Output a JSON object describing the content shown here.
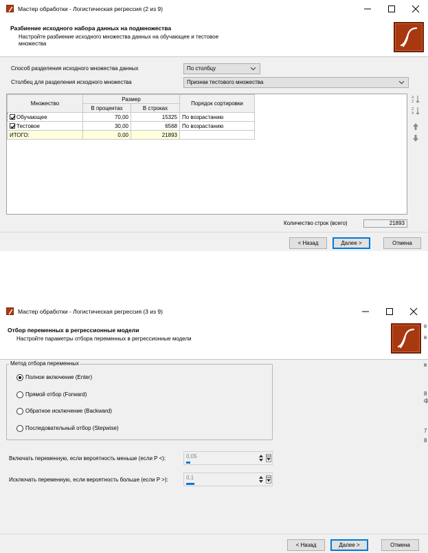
{
  "window1": {
    "title": "Мастер обработки - Логистическая регрессия (2 из 9)",
    "header_title": "Разбиение исходного набора данных на подмножества",
    "header_subtitle": "Настройте разбиение исходного множества данных на обучающее и тестовое множества",
    "split_method_label": "Способ разделения исходного множества данных",
    "split_method_value": "По столбцу",
    "split_column_label": "Столбец для разделения исходного множества",
    "split_column_value": "Признак тестового множества",
    "grid": {
      "col_set": "Множество",
      "col_size": "Размер",
      "col_percent": "В процентах",
      "col_rows": "В строках",
      "col_sort": "Порядок сортировки",
      "rows": [
        {
          "name": "Обучающее",
          "percent": "70,00",
          "rows": "15325",
          "sort": "По возрастанию",
          "checked": true
        },
        {
          "name": "Тестовое",
          "percent": "30,00",
          "rows": "6568",
          "sort": "По возрастанию",
          "checked": true
        }
      ],
      "total": {
        "name": "ИТОГО:",
        "percent": "0,00",
        "rows": "21893"
      }
    },
    "count_label": "Количество строк (всего)",
    "count_value": "21893",
    "back_label": "< Назад",
    "next_label": "Далее >",
    "cancel_label": "Отмена"
  },
  "window2": {
    "title": "Мастер обработки - Логистическая регрессия (3 из 9)",
    "header_title": "Отбор переменных в регрессионные модели",
    "header_subtitle": "Настройте параметры отбора переменных в регрессионные модели",
    "group_title": "Метод отбора переменных",
    "methods": [
      {
        "label": "Полное включение (Enter)",
        "selected": true
      },
      {
        "label": "Прямой отбор (Forward)",
        "selected": false
      },
      {
        "label": "Обратное исключение (Backward)",
        "selected": false
      },
      {
        "label": "Последовательный отбор (Stepwise)",
        "selected": false
      }
    ],
    "include_label": "Включать переменную, если вероятность меньше (если P <):",
    "include_value": "0,05",
    "exclude_label": "Исключать переменную, если вероятность больше (если P >):",
    "exclude_value": "0,1",
    "include_level": 0.05,
    "exclude_level": 0.1,
    "back_label": "< Назад",
    "next_label": "Далее >",
    "cancel_label": "Отмена"
  },
  "edge_chars": [
    "ё",
    "в",
    "в",
    "8",
    "ф",
    "7",
    "8"
  ],
  "colors": {
    "accent": "#0078d7",
    "logo": "#a83810",
    "grid_total": "#ffffdc"
  }
}
